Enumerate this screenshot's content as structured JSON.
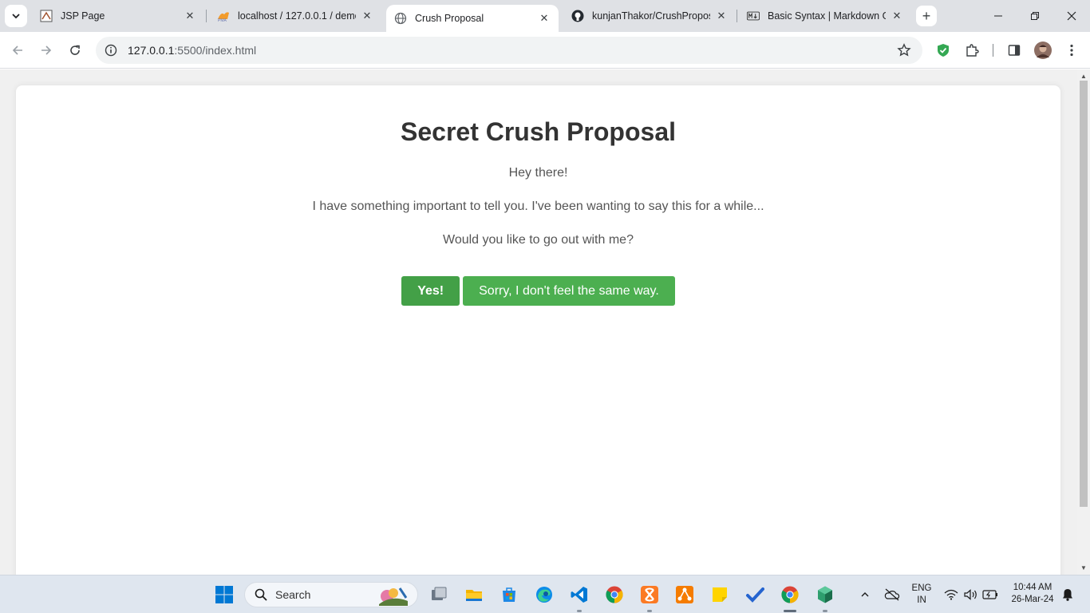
{
  "browser": {
    "tabs": [
      {
        "title": "JSP Page",
        "active": false
      },
      {
        "title": "localhost / 127.0.0.1 / demo",
        "active": false
      },
      {
        "title": "Crush Proposal",
        "active": true
      },
      {
        "title": "kunjanThakor/CrushProposal",
        "active": false
      },
      {
        "title": "Basic Syntax | Markdown Gu",
        "active": false
      }
    ],
    "address": {
      "host": "127.0.0.1",
      "path": ":5500/index.html"
    }
  },
  "page": {
    "heading": "Secret Crush Proposal",
    "greeting": "Hey there!",
    "message": "I have something important to tell you. I've been wanting to say this for a while...",
    "question": "Would you like to go out with me?",
    "yes_label": "Yes!",
    "no_label": "Sorry, I don't feel the same way."
  },
  "taskbar": {
    "search_label": "Search",
    "language": "ENG",
    "region": "IN",
    "time": "10:44 AM",
    "date": "26-Mar-24"
  },
  "colors": {
    "button_green": "#4caf50",
    "heading": "#333333"
  }
}
